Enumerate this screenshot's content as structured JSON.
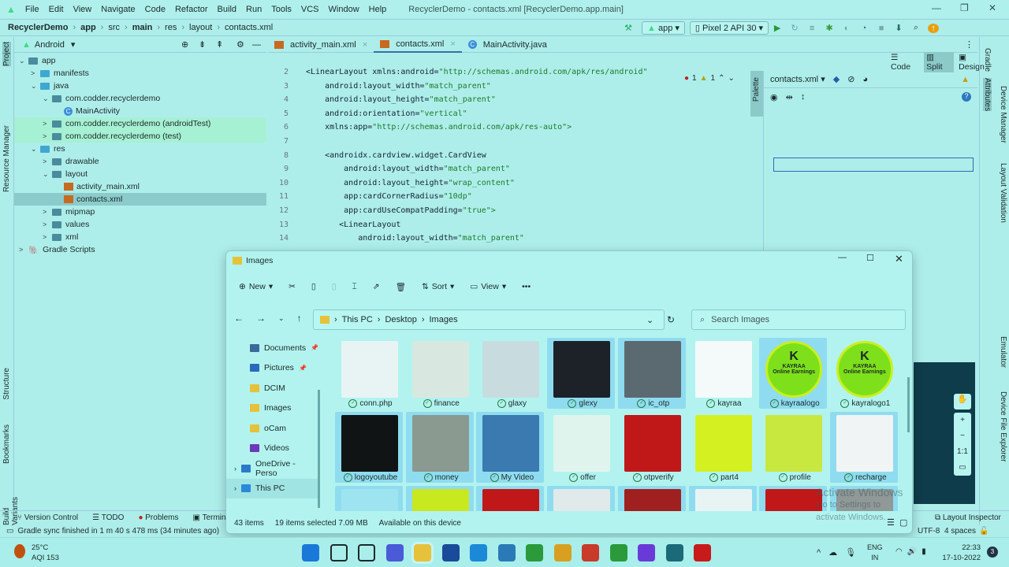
{
  "ide": {
    "menu": [
      "File",
      "Edit",
      "View",
      "Navigate",
      "Code",
      "Refactor",
      "Build",
      "Run",
      "Tools",
      "VCS",
      "Window",
      "Help"
    ],
    "window_title": "RecyclerDemo - contacts.xml [RecyclerDemo.app.main]",
    "breadcrumb": [
      "RecyclerDemo",
      "app",
      "src",
      "main",
      "res",
      "layout",
      "contacts.xml"
    ],
    "run_config": "app",
    "device": "Pixel 2 API 30",
    "project_view": "Android",
    "tree": [
      {
        "label": "app",
        "depth": 0,
        "arrow": "v",
        "kind": "module"
      },
      {
        "label": "manifests",
        "depth": 1,
        "arrow": ">",
        "kind": "folder-blue"
      },
      {
        "label": "java",
        "depth": 1,
        "arrow": "v",
        "kind": "folder-blue"
      },
      {
        "label": "com.codder.recyclerdemo",
        "depth": 2,
        "arrow": "v",
        "kind": "package"
      },
      {
        "label": "MainActivity",
        "depth": 3,
        "arrow": "",
        "kind": "class"
      },
      {
        "label": "com.codder.recyclerdemo (androidTest)",
        "depth": 2,
        "arrow": ">",
        "kind": "package",
        "state": "green"
      },
      {
        "label": "com.codder.recyclerdemo (test)",
        "depth": 2,
        "arrow": ">",
        "kind": "package",
        "state": "green"
      },
      {
        "label": "res",
        "depth": 1,
        "arrow": "v",
        "kind": "folder-blue"
      },
      {
        "label": "drawable",
        "depth": 2,
        "arrow": ">",
        "kind": "package"
      },
      {
        "label": "layout",
        "depth": 2,
        "arrow": "v",
        "kind": "package"
      },
      {
        "label": "activity_main.xml",
        "depth": 3,
        "arrow": "",
        "kind": "xml"
      },
      {
        "label": "contacts.xml",
        "depth": 3,
        "arrow": "",
        "kind": "xml",
        "state": "sel"
      },
      {
        "label": "mipmap",
        "depth": 2,
        "arrow": ">",
        "kind": "package"
      },
      {
        "label": "values",
        "depth": 2,
        "arrow": ">",
        "kind": "package"
      },
      {
        "label": "xml",
        "depth": 2,
        "arrow": ">",
        "kind": "package"
      },
      {
        "label": "Gradle Scripts",
        "depth": 0,
        "arrow": ">",
        "kind": "gradle"
      }
    ],
    "tabs": [
      {
        "label": "activity_main.xml",
        "active": false
      },
      {
        "label": "contacts.xml",
        "active": true
      },
      {
        "label": "MainActivity.java",
        "active": false
      }
    ],
    "view_modes": [
      "Code",
      "Split",
      "Design"
    ],
    "inspections": {
      "errors": "1",
      "warnings": "1"
    },
    "code": [
      {
        "n": "2",
        "t": "<LinearLayout xmlns:android=",
        "s": "\"http://schemas.android.com/apk/res/android\"",
        "i": 0
      },
      {
        "n": "3",
        "t": "    android:layout_width=",
        "s": "\"match_parent\"",
        "i": 0
      },
      {
        "n": "4",
        "t": "    android:layout_height=",
        "s": "\"match_parent\"",
        "i": 0
      },
      {
        "n": "5",
        "t": "    android:orientation=",
        "s": "\"vertical\"",
        "i": 0
      },
      {
        "n": "6",
        "t": "    xmlns:app=",
        "s": "\"http://schemas.android.com/apk/res-auto\">",
        "i": 0
      },
      {
        "n": "7",
        "t": "",
        "s": "",
        "i": 0
      },
      {
        "n": "8",
        "t": "    <androidx.cardview.widget.CardView",
        "s": "",
        "i": 0
      },
      {
        "n": "9",
        "t": "        android:layout_width=",
        "s": "\"match_parent\"",
        "i": 0
      },
      {
        "n": "10",
        "t": "        android:layout_height=",
        "s": "\"wrap_content\"",
        "i": 0
      },
      {
        "n": "11",
        "t": "        app:cardCornerRadius=",
        "s": "\"10dp\"",
        "i": 0
      },
      {
        "n": "12",
        "t": "        app:cardUseCompatPadding=",
        "s": "\"true\">",
        "i": 0
      },
      {
        "n": "13",
        "t": "       <LinearLayout",
        "s": "",
        "i": 0
      },
      {
        "n": "14",
        "t": "           android:layout_width=",
        "s": "\"match_parent\"",
        "i": 0
      }
    ],
    "design_file": "contacts.xml",
    "palette_label": "Palette",
    "left_strip": [
      "Project",
      "Resource Manager",
      "Structure",
      "Bookmarks",
      "Build Variants"
    ],
    "right_strip": [
      "Gradle",
      "Attributes",
      "Device Manager",
      "Layout Validation",
      "Emulator",
      "Device File Explorer"
    ],
    "bottom_tools": [
      "Version Control",
      "TODO",
      "Problems",
      "Terminal"
    ],
    "layout_inspector": "Layout Inspector",
    "status": "Gradle sync finished in 1 m 40 s 478 ms (34 minutes ago)",
    "encoding": "UTF-8",
    "indent": "4 spaces",
    "zoom_controls": [
      "+",
      "−",
      "1:1"
    ]
  },
  "explorer": {
    "title": "Images",
    "toolbar": {
      "new": "New",
      "sort": "Sort",
      "view": "View",
      "more": "•••"
    },
    "path": [
      "This PC",
      "Desktop",
      "Images"
    ],
    "search_placeholder": "Search Images",
    "nav": [
      "Documents",
      "Pictures",
      "DCIM",
      "Images",
      "oCam",
      "Videos",
      "OneDrive - Perso",
      "This PC"
    ],
    "files": [
      {
        "name": "conn.php",
        "sel": false,
        "color": "#e8f4f4"
      },
      {
        "name": "finance",
        "sel": false,
        "color": "#d8e8e0"
      },
      {
        "name": "glaxy",
        "sel": false,
        "color": "#c8dce0"
      },
      {
        "name": "glexy",
        "sel": true,
        "color": "#1c2228"
      },
      {
        "name": "ic_otp",
        "sel": true,
        "color": "#5a6a70"
      },
      {
        "name": "kayraa",
        "sel": false,
        "color": "#f4fafa"
      },
      {
        "name": "kayraalogo",
        "sel": true,
        "color": "#7ee01a"
      },
      {
        "name": "kayralogo1",
        "sel": false,
        "color": "#7ee01a"
      },
      {
        "name": "logoyoutube",
        "sel": true,
        "color": "#101414"
      },
      {
        "name": "money",
        "sel": true,
        "color": "#8a9a90"
      },
      {
        "name": "My Video",
        "sel": true,
        "color": "#3a7ab0"
      },
      {
        "name": "offer",
        "sel": false,
        "color": "#e0f4ee"
      },
      {
        "name": "otpverify",
        "sel": false,
        "color": "#c01818"
      },
      {
        "name": "part4",
        "sel": false,
        "color": "#d4f020"
      },
      {
        "name": "profile",
        "sel": false,
        "color": "#c8e840"
      },
      {
        "name": "recharge",
        "sel": true,
        "color": "#f0f4f4"
      }
    ],
    "logo_text": [
      "K",
      "KAYRAA",
      "Online Earnings"
    ],
    "status": {
      "count": "43 items",
      "selected": "19 items selected",
      "size": "7.09 MB",
      "avail": "Available on this device"
    },
    "watermark": [
      "Activate Windows",
      "Go to Settings to activate Windows."
    ]
  },
  "taskbar": {
    "weather_temp": "25°C",
    "weather_aqi": "AQI 153",
    "lang": "ENG",
    "region": "IN",
    "time": "22:33",
    "date": "17-10-2022",
    "badge": "3"
  }
}
